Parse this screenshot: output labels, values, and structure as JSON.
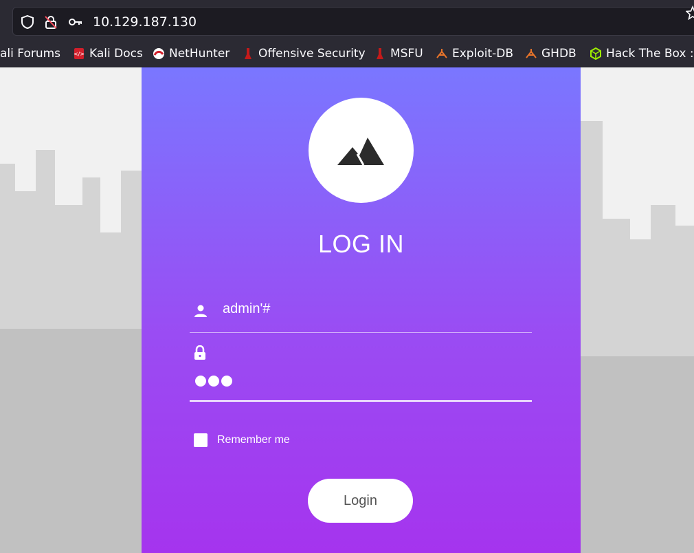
{
  "browser": {
    "url": "10.129.187.130",
    "icons": [
      "shield-icon",
      "no-lock-icon",
      "key-icon",
      "star-icon"
    ]
  },
  "bookmarks": [
    {
      "label": "ali Forums",
      "icon": "kali-icon"
    },
    {
      "label": "Kali Docs",
      "icon": "kali-docs-icon"
    },
    {
      "label": "NetHunter",
      "icon": "nethunter-icon"
    },
    {
      "label": "Offensive Security",
      "icon": "offsec-icon"
    },
    {
      "label": "MSFU",
      "icon": "offsec-icon"
    },
    {
      "label": "Exploit-DB",
      "icon": "exploitdb-icon"
    },
    {
      "label": "GHDB",
      "icon": "exploitdb-icon"
    },
    {
      "label": "Hack The Box ::",
      "icon": "htb-icon"
    }
  ],
  "login": {
    "title": "LOG IN",
    "username_value": "admin'#",
    "password_masked": "●●●",
    "remember_label": "Remember me",
    "remember_checked": false,
    "button_label": "Login"
  },
  "colors": {
    "card_top": "#7a77ff",
    "card_bottom": "#a534ee",
    "chrome": "#2b2a33"
  }
}
